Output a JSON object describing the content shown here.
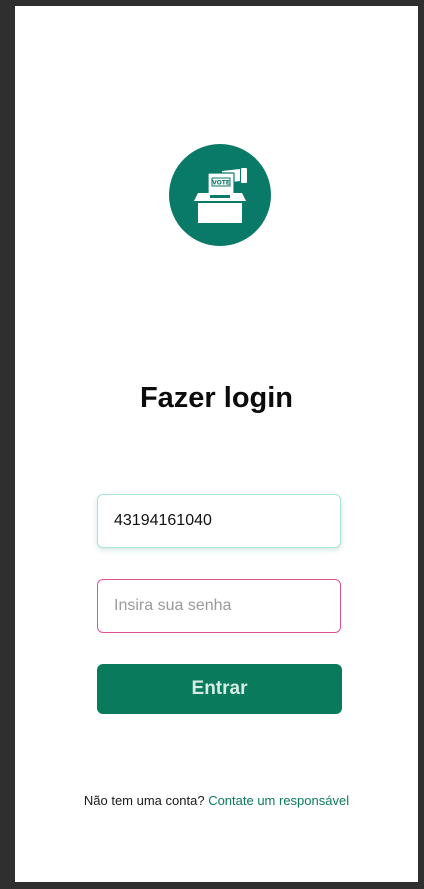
{
  "logo": {
    "badge_text": "VOTE",
    "icon": "ballot-box-icon"
  },
  "title": "Fazer login",
  "form": {
    "cpf_value": "43194161040",
    "password_placeholder": "Insira sua senha",
    "submit_label": "Entrar"
  },
  "footer": {
    "prompt": "Não tem uma conta?",
    "link": "Contate um responsável"
  },
  "colors": {
    "primary": "#0a7a5c",
    "logo_bg": "#0a7a68",
    "focus_border": "#e0509a",
    "valid_border": "#a8e6d4"
  }
}
